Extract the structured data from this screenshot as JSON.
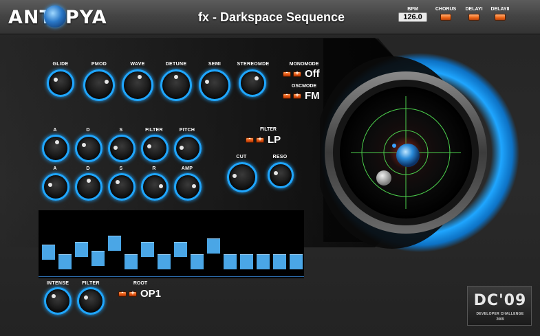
{
  "app": {
    "logo_left": "ANT",
    "logo_right": "PYA",
    "title": "fx - Darkspace Sequence",
    "bpm_label": "BPM",
    "bpm_value": "126.0"
  },
  "header_toggles": [
    {
      "label": "CHORUS"
    },
    {
      "label": "DELAYI"
    },
    {
      "label": "DELAYII"
    }
  ],
  "osc_knobs": [
    {
      "label": "GLIDE",
      "level": 0.3
    },
    {
      "label": "PMOD",
      "level": 0.75
    },
    {
      "label": "WAVE",
      "level": 0.55
    },
    {
      "label": "DETUNE",
      "level": 0.5
    },
    {
      "label": "SEMI",
      "level": 0.25
    },
    {
      "label": "STEREOMDE",
      "level": 0.65
    }
  ],
  "monomode": {
    "label": "MONOMODE",
    "value": "Off"
  },
  "oscmode": {
    "label": "OSCMODE",
    "value": "FM"
  },
  "env1_knobs": [
    {
      "label": "A",
      "level": 0.55
    },
    {
      "label": "D",
      "level": 0.3
    },
    {
      "label": "S",
      "level": 0.2
    },
    {
      "label": "FILTER",
      "level": 0.25
    },
    {
      "label": "PITCH",
      "level": 0.2
    }
  ],
  "env2_knobs": [
    {
      "label": "A",
      "level": 0.25
    },
    {
      "label": "D",
      "level": 0.5
    },
    {
      "label": "S",
      "level": 0.35
    },
    {
      "label": "R",
      "level": 0.8
    },
    {
      "label": "AMP",
      "level": 0.8
    }
  ],
  "filter": {
    "mode_label": "FILTER",
    "mode_value": "LP",
    "cut_label": "CUT",
    "cut_level": 0.2,
    "reso_label": "RESO",
    "reso_level": 0.25
  },
  "sequencer": {
    "steps": [
      0.5,
      0.35,
      0.55,
      0.4,
      0.65,
      0.35,
      0.55,
      0.35,
      0.55,
      0.35,
      0.6,
      0.35,
      0.35,
      0.35,
      0.35,
      0.35
    ]
  },
  "seq_controls": {
    "intense_label": "INTENSE",
    "intense_level": 0.35,
    "filter_label": "FILTER",
    "filter_level": 0.3,
    "root_label": "ROOT",
    "root_value": "OP1"
  },
  "badge": {
    "title": "DC'09",
    "subtitle": "DEVELOPER CHALLENGE",
    "year": "2009"
  },
  "colors": {
    "accent": "#1fa6ff",
    "led": "#f06a1a",
    "grid": "#4cd04c"
  }
}
